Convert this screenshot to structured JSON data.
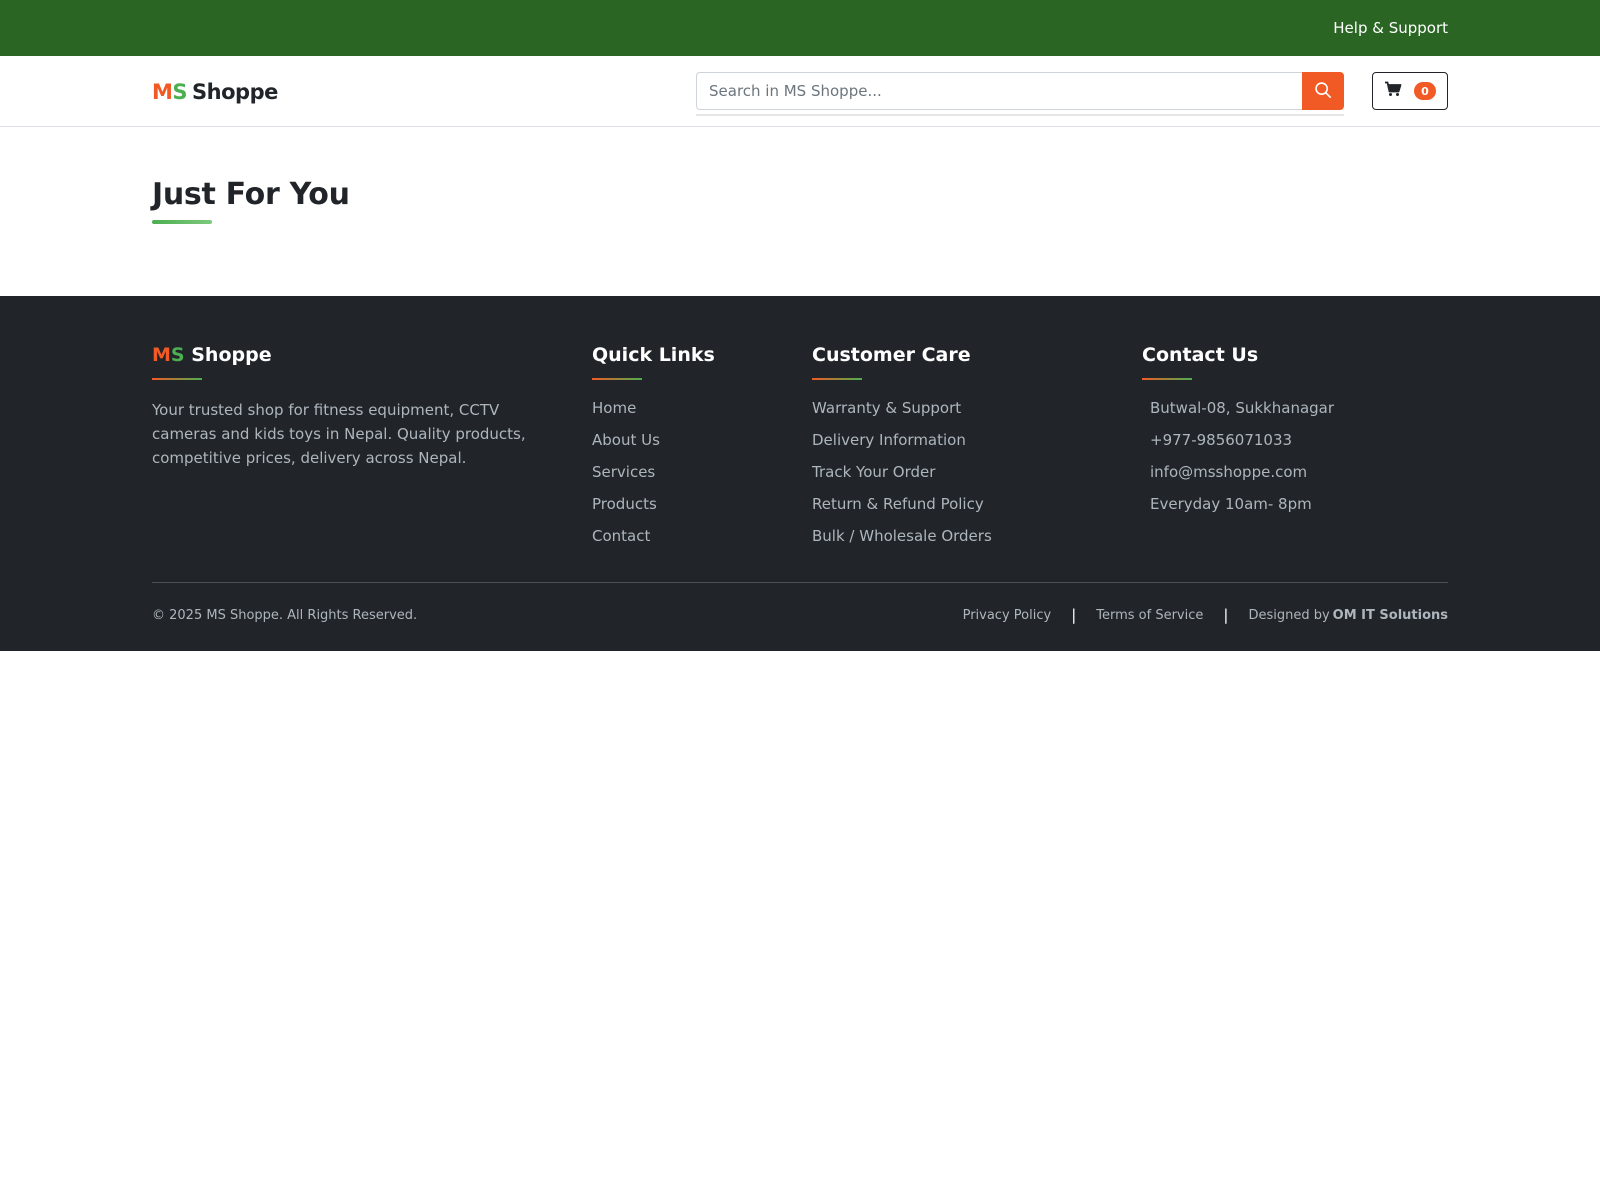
{
  "topbar": {
    "help_label": "Help & Support"
  },
  "header": {
    "logo": {
      "ms_m": "M",
      "ms_s": "S",
      "rest": "Shoppe"
    },
    "search": {
      "placeholder": "Search in MS Shoppe...",
      "value": ""
    },
    "cart": {
      "count": "0"
    }
  },
  "main": {
    "section_title": "Just For You"
  },
  "footer": {
    "brand": {
      "ms_m": "M",
      "ms_s": "S",
      "rest": "Shoppe"
    },
    "about": "Your trusted shop for fitness equipment, CCTV cameras and kids toys in Nepal. Quality products, competitive prices, delivery across Nepal.",
    "quick_links": {
      "title": "Quick Links",
      "items": [
        "Home",
        "About Us",
        "Services",
        "Products",
        "Contact"
      ]
    },
    "customer_care": {
      "title": "Customer Care",
      "items": [
        "Warranty & Support",
        "Delivery Information",
        "Track Your Order",
        "Return & Refund Policy",
        "Bulk / Wholesale Orders"
      ]
    },
    "contact": {
      "title": "Contact Us",
      "address": "Butwal-08, Sukkhanagar",
      "phone": "+977-9856071033",
      "email": "info@msshoppe.com",
      "hours": "Everyday 10am- 8pm"
    },
    "copyright": "© 2025 MS Shoppe. All Rights Reserved.",
    "privacy": "Privacy Policy",
    "terms": "Terms of Service",
    "designed_by_label": "Designed by",
    "designer": "OM IT Solutions"
  },
  "colors": {
    "topbar": "#2a6523",
    "accent_orange": "#f15a24",
    "accent_green": "#4caf50",
    "footer_bg": "#212529"
  },
  "icons": {
    "search": "search-icon",
    "cart": "cart-icon"
  }
}
